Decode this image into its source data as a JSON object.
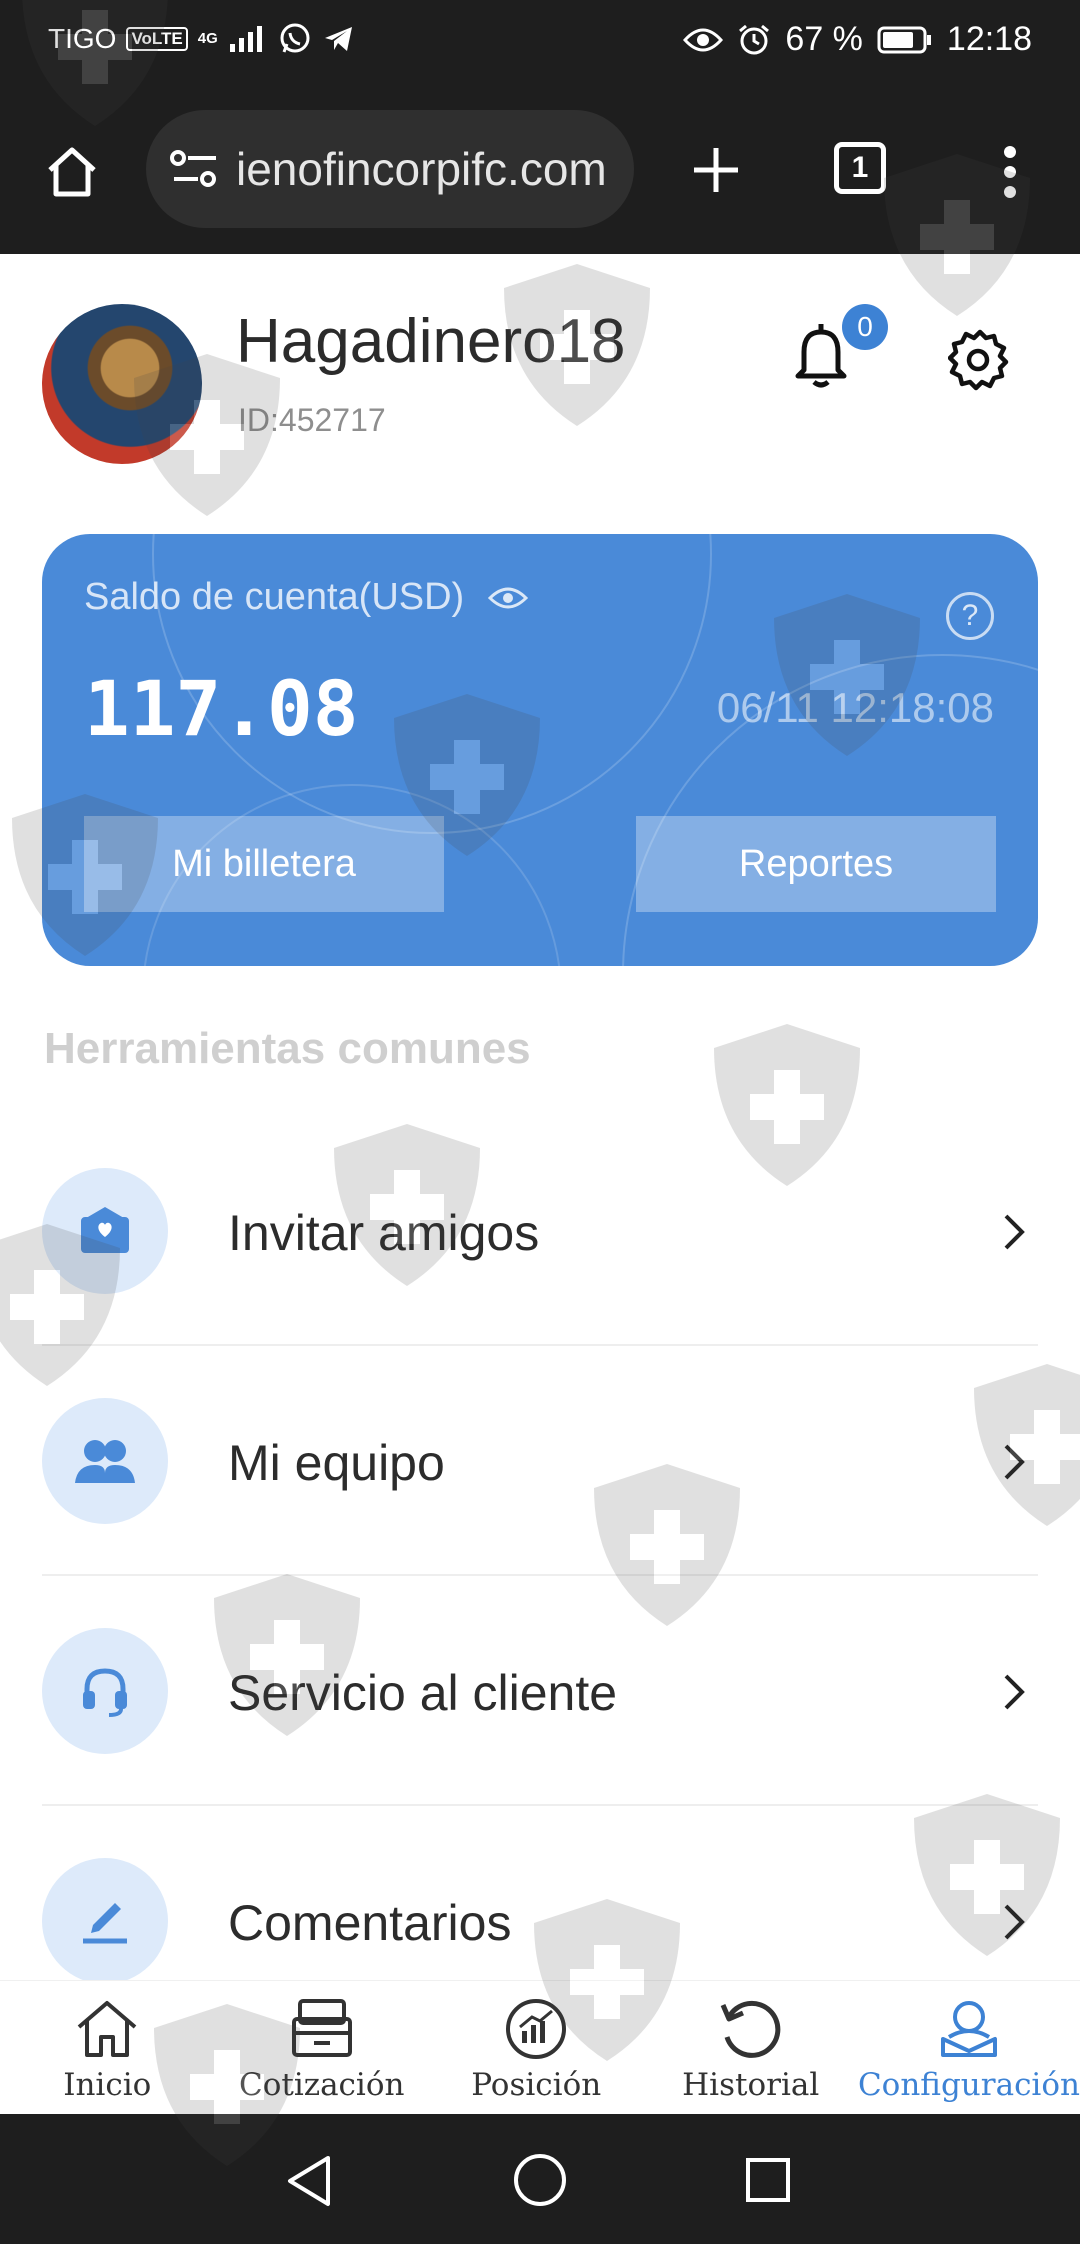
{
  "status_bar": {
    "carrier": "TIGO",
    "volte": "VoLTE",
    "network": "4G",
    "battery": "67 %",
    "time": "12:18"
  },
  "browser": {
    "url": "ienofincorpifc.com",
    "tab_count": "1"
  },
  "profile": {
    "username": "Hagadinero18",
    "user_id": "ID:452717",
    "notification_count": "0"
  },
  "balance_card": {
    "label": "Saldo de cuenta(USD)",
    "balance": "117.08",
    "timestamp": "06/11 12:18:08",
    "wallet_button": "Mi billetera",
    "reports_button": "Reportes",
    "help": "?"
  },
  "tools": {
    "title": "Herramientas comunes",
    "items": [
      {
        "label": "Invitar amigos",
        "icon": "invite-envelope-icon"
      },
      {
        "label": "Mi equipo",
        "icon": "team-icon"
      },
      {
        "label": "Servicio al cliente",
        "icon": "headset-icon"
      },
      {
        "label": "Comentarios",
        "icon": "pen-icon"
      }
    ]
  },
  "bottom_nav": {
    "items": [
      {
        "label": "Inicio",
        "icon": "home-icon"
      },
      {
        "label": "Cotización",
        "icon": "quotation-icon"
      },
      {
        "label": "Posición",
        "icon": "position-icon"
      },
      {
        "label": "Historial",
        "icon": "history-icon"
      },
      {
        "label": "Configuración",
        "icon": "profile-settings-icon",
        "active": true
      }
    ]
  },
  "colors": {
    "accent": "#3d82d4",
    "card": "#4a8ad8",
    "system_bar": "#1e1e1e"
  }
}
